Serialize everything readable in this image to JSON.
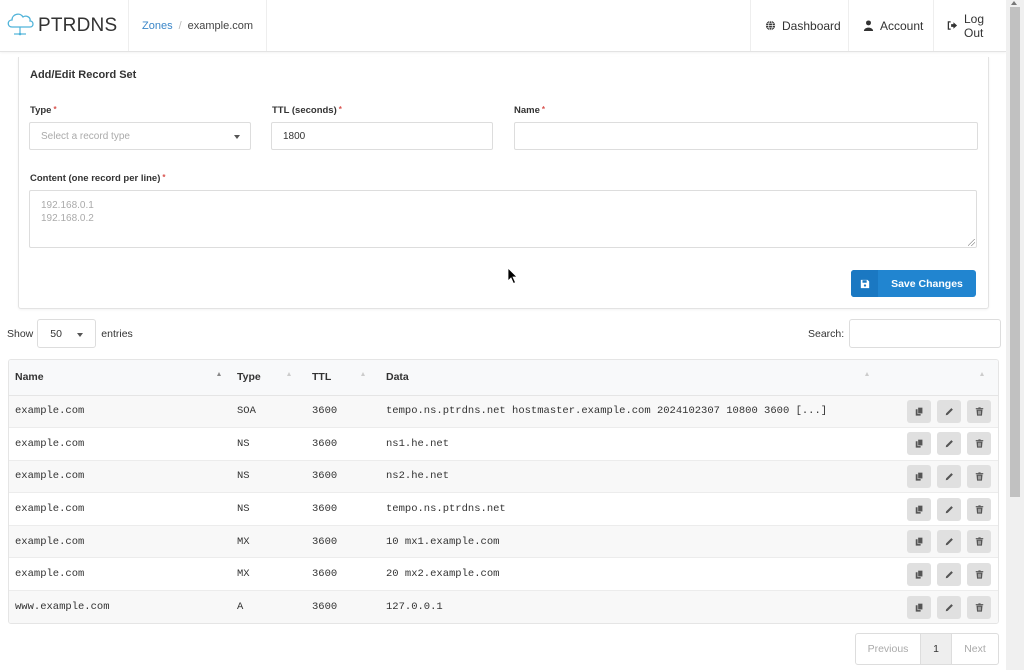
{
  "navbar": {
    "brand": "PTRDNS",
    "breadcrumb": {
      "link": "Zones",
      "separator": "/",
      "current": "example.com"
    },
    "items": [
      {
        "label": "Dashboard",
        "icon": "globe-icon"
      },
      {
        "label": "Account",
        "icon": "user-icon"
      },
      {
        "label": "Log Out",
        "icon": "sign-out-icon"
      }
    ]
  },
  "form": {
    "title": "Add/Edit Record Set",
    "required_marker": "*",
    "type": {
      "label": "Type",
      "placeholder": "Select a record type",
      "value": ""
    },
    "ttl": {
      "label": "TTL (seconds)",
      "value": "1800"
    },
    "name": {
      "label": "Name",
      "value": ""
    },
    "content": {
      "label": "Content (one record per line)",
      "placeholder_lines": [
        "192.168.0.1",
        "192.168.0.2"
      ],
      "value": ""
    },
    "save_label": "Save Changes"
  },
  "table_controls": {
    "show_label": "Show",
    "entries_label": "entries",
    "page_length": "50",
    "search_label": "Search:",
    "search_value": ""
  },
  "table": {
    "columns": [
      "Name",
      "Type",
      "TTL",
      "Data",
      ""
    ],
    "rows": [
      {
        "name": "example.com",
        "type": "SOA",
        "ttl": "3600",
        "data": "tempo.ns.ptrdns.net hostmaster.example.com 2024102307 10800 3600 [...]"
      },
      {
        "name": "example.com",
        "type": "NS",
        "ttl": "3600",
        "data": "ns1.he.net"
      },
      {
        "name": "example.com",
        "type": "NS",
        "ttl": "3600",
        "data": "ns2.he.net"
      },
      {
        "name": "example.com",
        "type": "NS",
        "ttl": "3600",
        "data": "tempo.ns.ptrdns.net"
      },
      {
        "name": "example.com",
        "type": "MX",
        "ttl": "3600",
        "data": "10 mx1.example.com"
      },
      {
        "name": "example.com",
        "type": "MX",
        "ttl": "3600",
        "data": "20 mx2.example.com"
      },
      {
        "name": "www.example.com",
        "type": "A",
        "ttl": "3600",
        "data": "127.0.0.1"
      }
    ],
    "row_actions": [
      "copy-icon",
      "pencil-icon",
      "trash-icon"
    ]
  },
  "pagination": {
    "previous": "Previous",
    "current": "1",
    "next": "Next"
  },
  "colors": {
    "primary": "#2185d0",
    "link": "#3a86c8",
    "required": "#d9534f"
  }
}
